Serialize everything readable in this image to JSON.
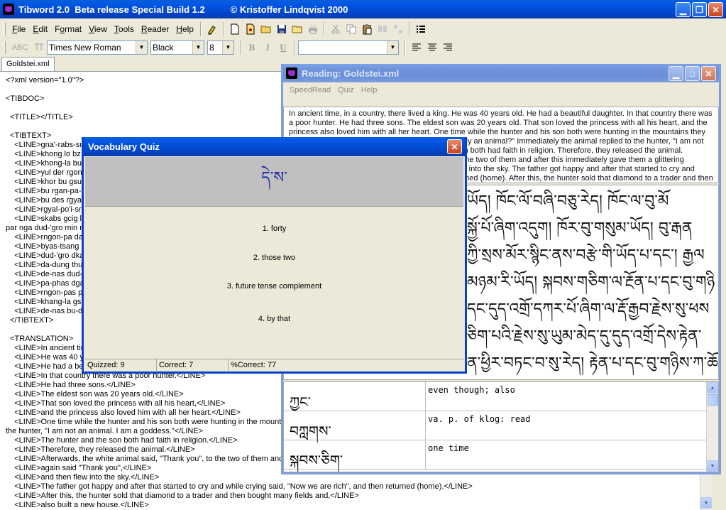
{
  "app": {
    "title": "Tibword 2.0  Beta release Special Build 1.2",
    "copyright": "© Kristoffer Lindqvist 2000"
  },
  "menu": [
    "File",
    "Edit",
    "Format",
    "View",
    "Tools",
    "Reader",
    "Help"
  ],
  "menu_underline": [
    "F",
    "E",
    "o",
    "V",
    "T",
    "R",
    "H"
  ],
  "format_bar": {
    "abc_label": "ABC",
    "font": "Times New Roman",
    "color": "Black",
    "size": "8",
    "bold": "B",
    "italic": "I",
    "underline": "U",
    "style_value": ""
  },
  "document_tab": "Goldstei.xml",
  "editor_lines": [
    "<?xml version=\"1.0\"?>",
    "",
    "<TIBDOC>",
    "",
    "  <TITLE></TITLE>",
    "",
    "  <TIBTEXT>",
    "    <LINE>gna'-rabs-su",
    "    <LINE>khong lo bz",
    "    <LINE>khong-la bu",
    "    <LINE>yul der rgon",
    "    <LINE>khor bu gsu",
    "    <LINE>bu rgan-pa-'",
    "    <LINE>bu des rgyal-",
    "    <LINE>rgyal-po'i-sra",
    "    <LINE>skabs gcig la",
    "par nga dud-'gro min n",
    "    <LINE>rngon-pa da",
    "    <LINE>byas-tsang k",
    "    <LINE>dud-'gro dka",
    "    <LINE>da-dung thu",
    "    <LINE>de-nas dud-'",
    "    <LINE>pa-phas dga",
    "    <LINE>rngon-pas ph",
    "    <LINE>khang-la gsa",
    "    <LINE>de-nas bu-de",
    "  </TIBTEXT>",
    "",
    "  <TRANSLATION>",
    "    <LINE>In ancient tin",
    "    <LINE>He was 40 y",
    "    <LINE>He had a be",
    "    <LINE>In that country there was a poor hunter.</LINE>",
    "    <LINE>He had three sons.</LINE>",
    "    <LINE>The eldest son was 20 years old.</LINE>",
    "    <LINE>That son loved the princess with all his heart,</LINE>",
    "    <LINE>and the princess also loved him with all her heart.</LINE>",
    "    <LINE>One time while the hunter and his son both were hunting in the mountains",
    "the hunter, \"I am not an animal. I am a goddess.\"</LINE>",
    "    <LINE>The hunter and the son both had faith in religion.</LINE>",
    "    <LINE>Therefore, they released the animal.</LINE>",
    "    <LINE>Afterwards, the white animal said, \"Thank you\", to the two of them and a",
    "    <LINE>again said \"Thank you\",</LINE>",
    "    <LINE>and then flew into the sky.</LINE>",
    "    <LINE>The father got happy and after that started to cry and while crying said, \"Now we are rich\", and then returned (home).</LINE>",
    "    <LINE>After this, the hunter sold that diamond to a trader and then bought many fields and,</LINE>",
    "    <LINE>also built a new house.</LINE>"
  ],
  "reading_window": {
    "title": "Reading: Goldstei.xml",
    "menu": [
      "SpeedRead",
      "Quiz",
      "Help"
    ],
    "text": "In ancient time, in a country, there lived a king. He was 40 years old. He had a beautiful daughter. In that country there was a poor hunter. He had three sons. The eldest son was 20 years old. That son loved the princess with all his heart, and the princess also loved him with all her heart. One time while the hunter and his son both were hunting in the mountains they snared a white animal. The hunter said, \"Is this really an animal?\" Immediately the animal replied to the hunter, \"I am not an animal. I am a goddess.\" The hunter and the son both had faith in religion. Therefore, they released the animal. Afterwards, the white animal said, \"Thank you\", to the two of them and after this immediately gave them a glittering diamond and again said \"Thank you\", and then flew into the sky. The father got happy and after that started to cry and while crying said, \"Now we are rich\", and then returned (home). After this, the hunter sold that diamond to a trader and then bought many fields",
    "tibetan_lines": [
      "ཡོད། ཁོང་ལོ་བཞི་བཅུ་རེད། ཁོང་ལ་བུ་མོ",
      "སྐྱོ་པོ་ཞིག་འདུག། ཁོར་བུ་གསུམ་ཡོད། བུ་རྒན",
      "ཀྱི་སྲས་མོར་སྙིང་ནས་བརྩེ་གི་ཡོད་པ་དང་། རྒྱལ",
      "མཉམ་རི་ཡོད། སྐབས་གཅིག་ལ་རྔོན་པ་དང་བུ་གཉི",
      "དང་དུད་འགྲོ་དཀར་པོ་ཞིག་ལ་རྡོ་རྒྱབ་རྗེས་སུ་ཕས",
      "ཅིག་པའི་རྗེས་སུ་ཡུམ་མེད་དུ་དུད་འགྲོ་དེས་རྟེན་",
      "ན་ཕྱིར་བཏང་བ་སུ་རེད། རྟེན་པ་དང་བུ་གཉིས་ཀ་ཆོས"
    ],
    "vocab": [
      {
        "tibetan": "ཀྱང་",
        "definition": "even though; also"
      },
      {
        "tibetan": "བཀླགས་",
        "definition": "va. p. of klog: read"
      },
      {
        "tibetan": "སྐབས་ཅིག་",
        "definition": "one time"
      }
    ]
  },
  "quiz": {
    "title": "Vocabulary Quiz",
    "word": "དེ་ས་",
    "answers": [
      "1. forty",
      "2. those two",
      "3. future tense complement",
      "4. by that"
    ],
    "status": {
      "quizzed": "Quizzed: 9",
      "correct": "Correct: 7",
      "percent": "%Correct: 77"
    }
  },
  "colors": {
    "title_active": "#0058e6",
    "title_inactive": "#7b9ee3",
    "window_bg": "#ece9d8",
    "quiz_word": "#1a27a8"
  }
}
